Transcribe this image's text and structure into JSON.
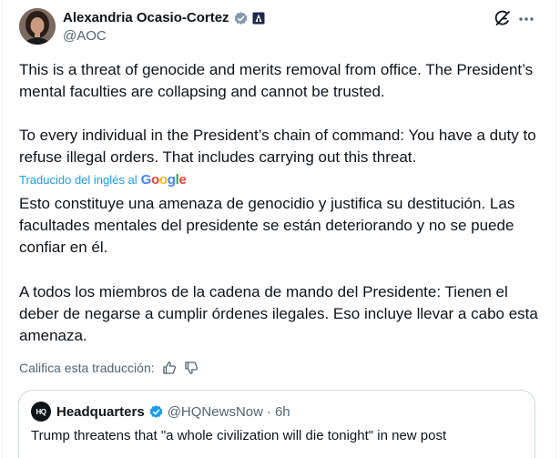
{
  "tweet": {
    "author_name": "Alexandria Ocasio-Cortez",
    "author_handle": "@AOC",
    "original_paragraphs": [
      "This is a threat of genocide and merits removal from office. The President’s mental faculties are collapsing and cannot be trusted.",
      "To every individual in the President’s chain of command: You have a duty to refuse illegal orders. That includes carrying out this threat."
    ],
    "translated_by_label": "Traducido del inglés al",
    "translation_provider": "Google",
    "translated_paragraphs": [
      "Esto constituye una amenaza de genocidio y justifica su destitución. Las facultades mentales del presidente se están deteriorando y no se puede confiar en él.",
      "A todos los miembros de la cadena de mando del Presidente: Tienen el deber de negarse a cumplir órdenes ilegales. Eso incluye llevar a cabo esta amenaza."
    ],
    "rate_translation_label": "Califica esta traducción:",
    "icons": [
      "verified-badge-icon",
      "affiliation-icon",
      "grok-icon",
      "more-icon",
      "thumbs-up-icon",
      "thumbs-down-icon"
    ]
  },
  "quoted_tweet": {
    "avatar_text": "HQ",
    "author_name": "Headquarters",
    "author_handle": "@HQNewsNow",
    "separator": "·",
    "time": "6h",
    "text": "Trump threatens that \"a whole civilization will die tonight\" in new post"
  },
  "colors": {
    "text": "#0f1419",
    "secondary": "#536471",
    "accent": "#1d9bf0",
    "border": "#cfd9de"
  }
}
